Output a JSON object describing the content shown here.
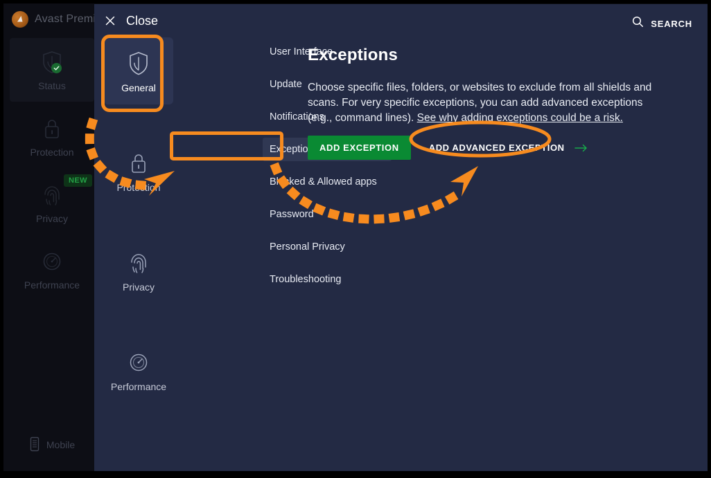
{
  "window": {
    "app_title": "Avast Premi",
    "logo_icon": "avast-logo-icon"
  },
  "rail": {
    "items": [
      {
        "label": "Status",
        "icon": "shield-check-icon",
        "active": true,
        "badge": ""
      },
      {
        "label": "Protection",
        "icon": "lock-icon",
        "active": false,
        "badge": ""
      },
      {
        "label": "Privacy",
        "icon": "fingerprint-icon",
        "active": false,
        "badge": "NEW"
      },
      {
        "label": "Performance",
        "icon": "speedometer-icon",
        "active": false,
        "badge": ""
      }
    ],
    "mobile": {
      "label": "Mobile",
      "icon": "phone-icon"
    }
  },
  "settings": {
    "close": {
      "label": "Close",
      "icon": "close-x-icon"
    },
    "search": {
      "label": "SEARCH",
      "icon": "search-icon"
    },
    "categories": [
      {
        "label": "General",
        "icon": "shield-icon",
        "selected": true
      },
      {
        "label": "Protection",
        "icon": "lock-icon",
        "selected": false
      },
      {
        "label": "Privacy",
        "icon": "fingerprint-icon",
        "selected": false
      },
      {
        "label": "Performance",
        "icon": "speedometer-icon",
        "selected": false
      }
    ],
    "submenu": [
      {
        "label": "User Interface",
        "active": false
      },
      {
        "label": "Update",
        "active": false
      },
      {
        "label": "Notifications",
        "active": false
      },
      {
        "label": "Exceptions",
        "active": true
      },
      {
        "label": "Blocked & Allowed apps",
        "active": false
      },
      {
        "label": "Password",
        "active": false
      },
      {
        "label": "Personal Privacy",
        "active": false
      },
      {
        "label": "Troubleshooting",
        "active": false
      }
    ],
    "content": {
      "title": "Exceptions",
      "description": "Choose specific files, folders, or websites to exclude from all shields and scans. For very specific exceptions, you can add advanced exceptions (e.g., command lines). ",
      "risk_link": "See why adding exceptions could be a risk.",
      "add_exception_label": "ADD EXCEPTION",
      "add_advanced_label": "ADD ADVANCED EXCEPTION",
      "advanced_arrow_icon": "arrow-right-icon"
    }
  },
  "colors": {
    "accent_orange": "#f78b1f",
    "panel_bg": "#232a44",
    "rail_bg": "#0d0e15",
    "green_button": "#0a8a33",
    "green_arrow": "#17a84a",
    "badge_green_text": "#23a045"
  },
  "annotations": {
    "highlight_general": "orange-rounded-rect-around-general",
    "highlight_exceptions": "orange-rect-around-exceptions",
    "highlight_advanced": "orange-ellipse-around-add-advanced-exception",
    "arrow_to_exceptions": "orange-dotted-curved-arrow",
    "arrow_to_advanced": "orange-dotted-curved-arrow"
  }
}
